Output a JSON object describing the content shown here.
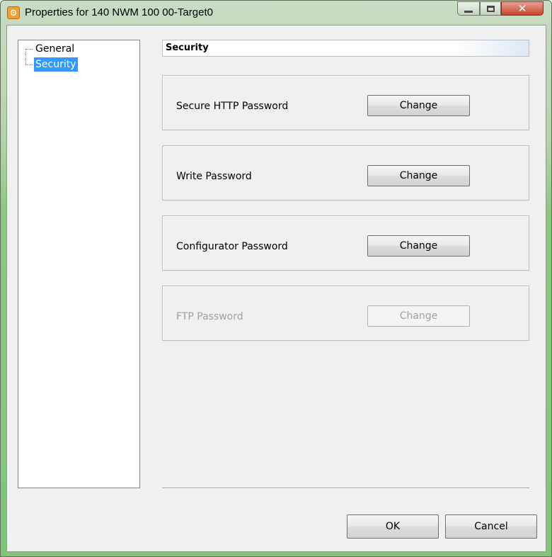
{
  "window": {
    "title": "Properties for 140 NWM 100 00-Target0",
    "controls": {
      "minimize": "",
      "maximize": "",
      "close": "✕"
    }
  },
  "tree": {
    "items": [
      {
        "label": "General",
        "selected": false
      },
      {
        "label": "Security",
        "selected": true
      }
    ]
  },
  "section": {
    "header": "Security",
    "groups": [
      {
        "label": "Secure HTTP Password",
        "button": "Change",
        "enabled": true
      },
      {
        "label": "Write Password",
        "button": "Change",
        "enabled": true
      },
      {
        "label": "Configurator Password",
        "button": "Change",
        "enabled": true
      },
      {
        "label": "FTP Password",
        "button": "Change",
        "enabled": false
      }
    ]
  },
  "footer": {
    "ok_label": "OK",
    "cancel_label": "Cancel"
  },
  "colors": {
    "selection": "#3399ff",
    "frame": "#82c57a",
    "disabled_text": "#a0a0a0"
  }
}
